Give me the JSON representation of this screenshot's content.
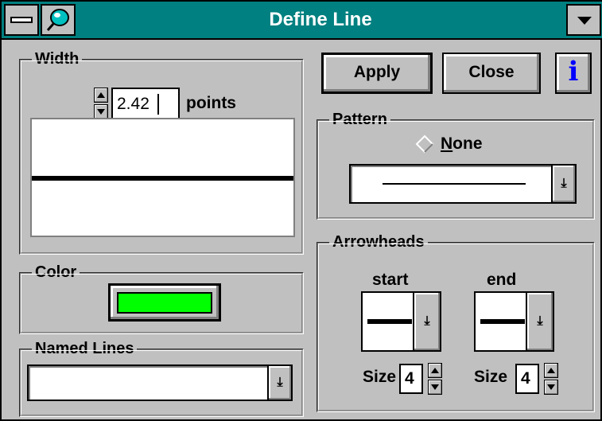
{
  "window": {
    "title": "Define Line",
    "titlebar_color": "#008080",
    "icons": {
      "system_menu": "system-menu-icon",
      "app": "app-icon",
      "dropdown": "chevron-down-icon"
    }
  },
  "buttons": {
    "apply_label": "Apply",
    "close_label": "Close",
    "info_label": "i"
  },
  "width_group": {
    "legend": "Width",
    "value": "2.42",
    "units": "points"
  },
  "color_group": {
    "legend": "Color",
    "swatch_color": "#00ff00"
  },
  "named_lines_group": {
    "legend": "Named Lines",
    "value": ""
  },
  "pattern_group": {
    "legend": "Pattern",
    "none_label_access": "N",
    "none_label_rest": "one",
    "none_selected": false
  },
  "arrowheads_group": {
    "legend": "Arrowheads",
    "start": {
      "label": "start",
      "size_label": "Size",
      "size_value": "4"
    },
    "end": {
      "label": "end",
      "size_label": "Size",
      "size_value": "4"
    }
  }
}
